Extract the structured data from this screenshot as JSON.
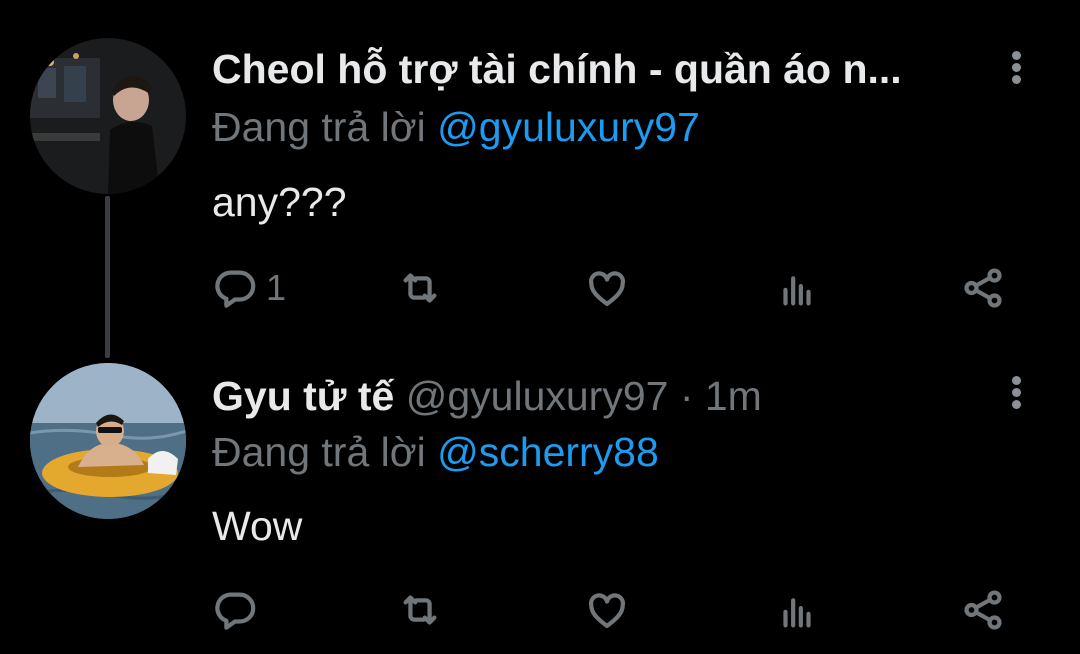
{
  "tweets": [
    {
      "display_name": "Cheol hỗ trợ tài chính - quần áo n...",
      "handle_meta": "",
      "replying_prefix": "Đang trả lời ",
      "replying_to": "@gyuluxury97",
      "body": "any???",
      "reply_count": "1"
    },
    {
      "display_name": "Gyu tử tế",
      "handle_meta": "@gyuluxury97 · 1m",
      "replying_prefix": "Đang trả lời ",
      "replying_to": "@scherry88",
      "body": "Wow",
      "reply_count": ""
    }
  ],
  "colors": {
    "background": "#000000",
    "text": "#e7e9ea",
    "secondary": "#71767b",
    "link": "#1d9bf0"
  },
  "icons": [
    "reply-icon",
    "retweet-icon",
    "like-icon",
    "views-icon",
    "share-icon",
    "more-options-icon"
  ]
}
